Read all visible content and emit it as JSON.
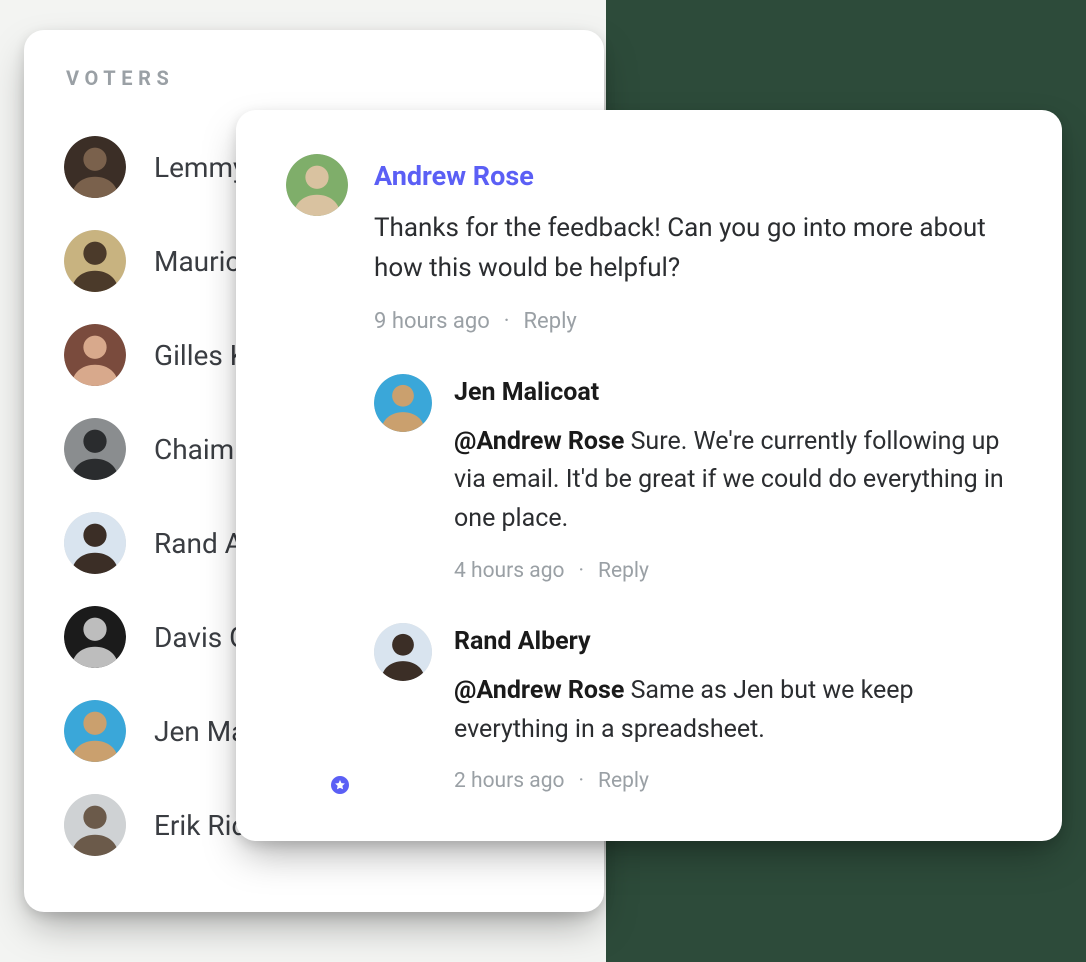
{
  "voters": {
    "title": "VOTERS",
    "items": [
      {
        "name": "Lemmy",
        "colors": [
          "#3b2e26",
          "#7a614c"
        ]
      },
      {
        "name": "Maurice",
        "colors": [
          "#c8b380",
          "#4b3a2a"
        ]
      },
      {
        "name": "Gilles Ke",
        "colors": [
          "#7a4b3d",
          "#d8a98c"
        ]
      },
      {
        "name": "Chaim S",
        "colors": [
          "#8a8d8f",
          "#2a2c2e"
        ]
      },
      {
        "name": "Rand Albery",
        "colors": [
          "#d9e4ef",
          "#3b2e26"
        ]
      },
      {
        "name": "Davis G",
        "colors": [
          "#1b1b1b",
          "#bdbdbd"
        ]
      },
      {
        "name": "Jen Malicoat",
        "colors": [
          "#3aa7d9",
          "#caa06e"
        ]
      },
      {
        "name": "Erik Rid",
        "colors": [
          "#cfd2d4",
          "#6b5a4a"
        ]
      }
    ]
  },
  "comments": {
    "root": {
      "author": "Andrew Rose",
      "isAdmin": true,
      "avatarColors": [
        "#7fae6a",
        "#d9c2a0"
      ],
      "message": "Thanks for the feedback! Can you go into more about how this would be helpful?",
      "time": "9 hours ago",
      "replyLabel": "Reply"
    },
    "replies": [
      {
        "author": "Jen Malicoat",
        "avatarColors": [
          "#3aa7d9",
          "#caa06e"
        ],
        "mention": "@Andrew Rose",
        "message": " Sure. We're currently following up via email. It'd be great if we could do everything in one place.",
        "time": "4 hours ago",
        "replyLabel": "Reply"
      },
      {
        "author": "Rand Albery",
        "avatarColors": [
          "#d9e4ef",
          "#3b2e26"
        ],
        "mention": "@Andrew Rose",
        "message": " Same as Jen but we keep everything in a spreadsheet.",
        "time": "2 hours ago",
        "replyLabel": "Reply"
      }
    ]
  }
}
